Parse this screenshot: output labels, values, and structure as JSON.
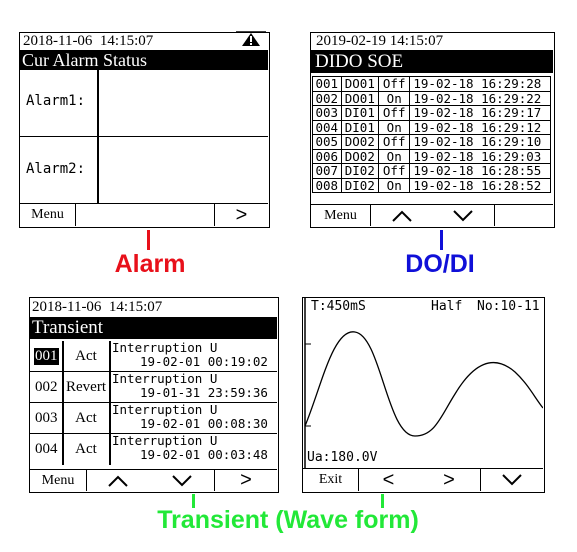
{
  "alarm_screen": {
    "datetime": "2018-11-06  14:15:07",
    "title": "Cur Alarm Status",
    "rows": [
      {
        "label": "Alarm1:"
      },
      {
        "label": "Alarm2:"
      }
    ],
    "softkeys": {
      "menu": "Menu",
      "blank": "",
      "next": ">"
    },
    "icon": "warning-icon"
  },
  "dido_screen": {
    "datetime": "2019-02-19 14:15:07",
    "title": "DIDO SOE",
    "rows": [
      {
        "num": "001",
        "ch": "DO01",
        "state": "Off",
        "time": "19-02-18 16:29:28"
      },
      {
        "num": "002",
        "ch": "DO01",
        "state": "On",
        "time": "19-02-18 16:29:22"
      },
      {
        "num": "003",
        "ch": "DI01",
        "state": "Off",
        "time": "19-02-18 16:29:17"
      },
      {
        "num": "004",
        "ch": "DI01",
        "state": "On",
        "time": "19-02-18 16:29:12"
      },
      {
        "num": "005",
        "ch": "DO02",
        "state": "Off",
        "time": "19-02-18 16:29:10"
      },
      {
        "num": "006",
        "ch": "DO02",
        "state": "On",
        "time": "19-02-18 16:29:03"
      },
      {
        "num": "007",
        "ch": "DI02",
        "state": "Off",
        "time": "19-02-18 16:28:55"
      },
      {
        "num": "008",
        "ch": "DI02",
        "state": "On",
        "time": "19-02-18 16:28:52"
      }
    ],
    "softkeys": {
      "menu": "Menu",
      "up": "chevron-up-icon",
      "down": "chevron-down-icon",
      "blank": ""
    }
  },
  "transient_screen": {
    "datetime": "2018-11-06  14:15:07",
    "title": "Transient",
    "rows": [
      {
        "num": "001",
        "type": "Act",
        "event": "Interruption U",
        "time": "19-02-01 00:19:02",
        "selected": true
      },
      {
        "num": "002",
        "type": "Revert",
        "event": "Interruption U",
        "time": "19-01-31 23:59:36",
        "selected": false
      },
      {
        "num": "003",
        "type": "Act",
        "event": "Interruption U",
        "time": "19-02-01 00:08:30",
        "selected": false
      },
      {
        "num": "004",
        "type": "Act",
        "event": "Interruption U",
        "time": "19-02-01 00:03:48",
        "selected": false
      }
    ],
    "softkeys": {
      "menu": "Menu",
      "up": "chevron-up-icon",
      "down": "chevron-down-icon",
      "next": ">"
    }
  },
  "waveform_screen": {
    "period": "T:450mS",
    "mode": "Half",
    "number": "No:10-11",
    "reading": "Ua:180.0V",
    "softkeys": {
      "exit": "Exit",
      "prev": "<",
      "next": ">",
      "down": "chevron-down-icon"
    }
  },
  "captions": {
    "alarm": "Alarm",
    "dodi": "DO/DI",
    "transient": "Transient  (Wave form)"
  },
  "colors": {
    "alarm": "#e8101a",
    "dodi": "#1010d8",
    "transient": "#22e838",
    "selected_bg": "#000000",
    "screen_bg": "#ffffff"
  }
}
